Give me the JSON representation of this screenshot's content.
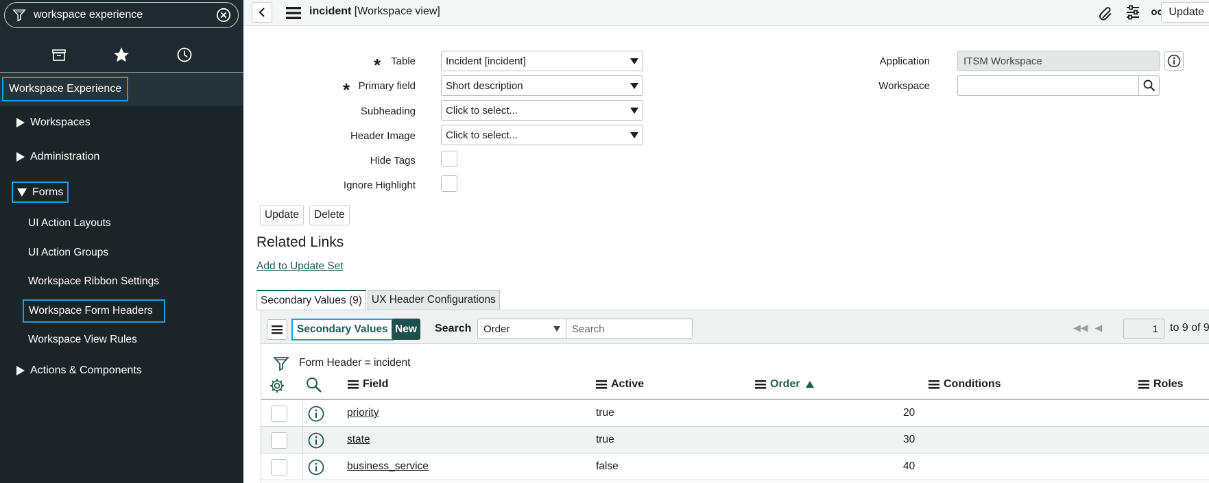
{
  "sidebar": {
    "filter_text": "workspace experience",
    "app_title": "Workspace Experience",
    "modules": [
      {
        "label": "Workspaces",
        "expanded": false
      },
      {
        "label": "Administration",
        "expanded": false
      },
      {
        "label": "Forms",
        "expanded": true
      },
      {
        "label": "Actions & Components",
        "expanded": false
      }
    ],
    "forms_items": [
      "UI Action Layouts",
      "UI Action Groups",
      "Workspace Ribbon Settings",
      "Workspace Form Headers",
      "Workspace View Rules"
    ]
  },
  "header": {
    "title_table": "incident",
    "title_view": "[Workspace view]",
    "update_label": "Update"
  },
  "form": {
    "table_label": "Table",
    "table_value": "Incident [incident]",
    "primary_label": "Primary field",
    "primary_value": "Short description",
    "subheading_label": "Subheading",
    "subheading_value": "Click to select...",
    "header_image_label": "Header Image",
    "header_image_value": "Click to select...",
    "hide_tags_label": "Hide Tags",
    "ignore_highlight_label": "Ignore Highlight",
    "application_label": "Application",
    "application_value": "ITSM Workspace",
    "workspace_label": "Workspace",
    "update_button": "Update",
    "delete_button": "Delete"
  },
  "related": {
    "heading": "Related Links",
    "link": "Add to Update Set"
  },
  "tabs": [
    {
      "label": "Secondary Values (9)",
      "active": true
    },
    {
      "label": "UX Header Configurations",
      "active": false
    }
  ],
  "list": {
    "title": "Secondary Values",
    "new_label": "New",
    "search_label": "Search",
    "search_field": "Order",
    "search_placeholder": "Search",
    "page": "1",
    "page_range": "to 9 of 9",
    "breadcrumb": "Form Header = incident",
    "columns": {
      "field": "Field",
      "active": "Active",
      "order": "Order",
      "conditions": "Conditions",
      "roles": "Roles"
    },
    "rows": [
      {
        "field": "priority",
        "active": "true",
        "order": "20"
      },
      {
        "field": "state",
        "active": "true",
        "order": "30"
      },
      {
        "field": "business_service",
        "active": "false",
        "order": "40"
      }
    ]
  },
  "colors": {
    "sidebar_bg": "#1f2a2e",
    "highlight": "#1aa1e0",
    "accent": "#1f5b53"
  }
}
